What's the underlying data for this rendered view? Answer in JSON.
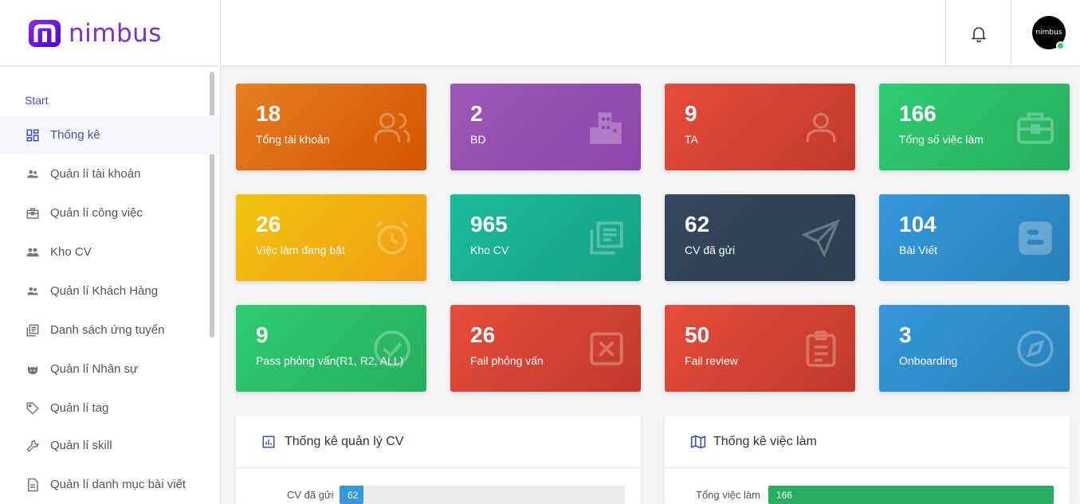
{
  "header": {
    "brand": "nimbus",
    "avatar_text": "nimbus",
    "icons": {
      "logo": "nimbus-logo-icon",
      "notifications": "bell-icon"
    }
  },
  "sidebar": {
    "section": "Start",
    "items": [
      {
        "label": "Thống kê",
        "icon": "dashboard-icon",
        "active": true
      },
      {
        "label": "Quản lí tài khoản",
        "icon": "users-icon"
      },
      {
        "label": "Quản lí công việc",
        "icon": "briefcase-icon"
      },
      {
        "label": "Kho CV",
        "icon": "people-icon"
      },
      {
        "label": "Quản lí Khách Hàng",
        "icon": "customers-icon"
      },
      {
        "label": "Danh sách ứng tuyển",
        "icon": "list-icon"
      },
      {
        "label": "Quản lí Nhân sự",
        "icon": "github-icon"
      },
      {
        "label": "Quản lí tag",
        "icon": "tag-icon"
      },
      {
        "label": "Quản lí skill",
        "icon": "wrench-icon"
      },
      {
        "label": "Quản lí danh mục bài viết",
        "icon": "document-icon"
      }
    ]
  },
  "cards": [
    {
      "value": "18",
      "label": "Tổng tài khoản",
      "icon": "users-icon",
      "color": "#e67e22"
    },
    {
      "value": "2",
      "label": "BD",
      "icon": "building-icon",
      "color": "#9b59b6"
    },
    {
      "value": "9",
      "label": "TA",
      "icon": "user-icon",
      "color": "#e74c3c"
    },
    {
      "value": "166",
      "label": "Tổng số việc làm",
      "icon": "toolbox-icon",
      "color": "#2ecc71"
    },
    {
      "value": "26",
      "label": "Việc làm đang bật",
      "icon": "alarm-icon",
      "color": "#f1c40f"
    },
    {
      "value": "965",
      "label": "Kho CV",
      "icon": "library-icon",
      "color": "#1abc9c"
    },
    {
      "value": "62",
      "label": "CV đã gửi",
      "icon": "send-icon",
      "color": "#34495e"
    },
    {
      "value": "104",
      "label": "Bài Viết",
      "icon": "blogger-icon",
      "color": "#3498db"
    },
    {
      "value": "9",
      "label": "Pass phỏng vấn(R1, R2, ALL)",
      "icon": "check-circle-icon",
      "color": "#2ecc71"
    },
    {
      "value": "26",
      "label": "Fail phỏng vấn",
      "icon": "close-box-icon",
      "color": "#e74c3c"
    },
    {
      "value": "50",
      "label": "Fail review",
      "icon": "clipboard-icon",
      "color": "#e74c3c"
    },
    {
      "value": "3",
      "label": "Onboarding",
      "icon": "compass-icon",
      "color": "#3498db"
    }
  ],
  "panels": {
    "cv": {
      "title": "Thống kê quản lý CV",
      "icon": "bar-chart-icon",
      "rows": [
        {
          "label": "CV đã gửi",
          "value": "62",
          "fraction": 0.084,
          "color": "#3498db"
        }
      ]
    },
    "jobs": {
      "title": "Thống kê việc làm",
      "icon": "map-icon",
      "rows": [
        {
          "label": "Tổng việc làm",
          "value": "166",
          "fraction": 1.0,
          "color": "#27ae60"
        }
      ]
    }
  }
}
